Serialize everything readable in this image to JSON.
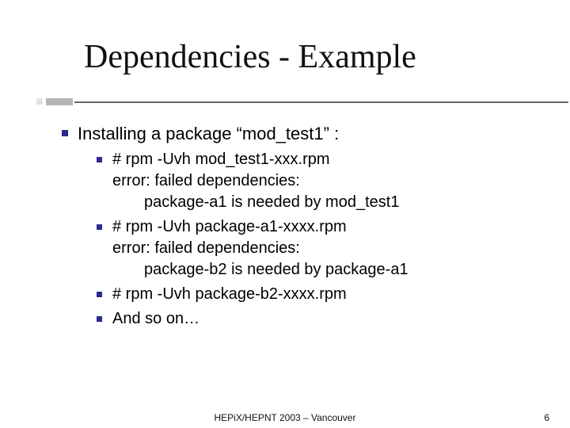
{
  "title": "Dependencies - Example",
  "bullet1": {
    "text": "Installing a package “mod_test1” :",
    "subs": [
      {
        "line1": "# rpm -Uvh mod_test1-xxx.rpm",
        "line2": "error: failed dependencies:",
        "line3": "package-a1 is needed by mod_test1"
      },
      {
        "line1": "# rpm -Uvh package-a1-xxxx.rpm",
        "line2": "error: failed dependencies:",
        "line3": "package-b2 is needed by package-a1"
      },
      {
        "line1": "# rpm -Uvh package-b2-xxxx.rpm"
      },
      {
        "line1": "And so on…"
      }
    ]
  },
  "footer": {
    "center": "HEPiX/HEPNT 2003 – Vancouver",
    "page": "6"
  }
}
